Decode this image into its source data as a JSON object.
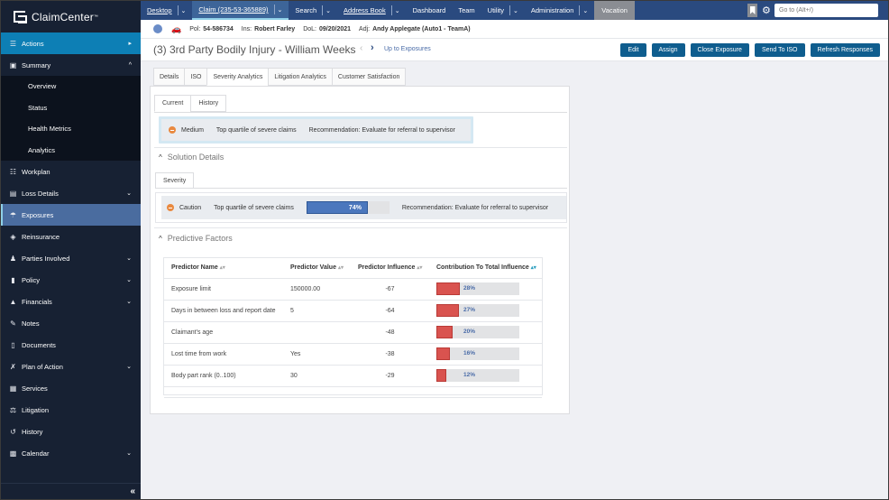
{
  "app": {
    "name": "ClaimCenter",
    "tm": "™"
  },
  "sidebar": {
    "items": [
      {
        "label": "Actions",
        "icon": "actions-icon",
        "chevron": "▸"
      },
      {
        "label": "Summary",
        "icon": "summary-icon",
        "chevron": "^"
      },
      {
        "label": "Workplan",
        "icon": "workplan-icon",
        "chevron": ""
      },
      {
        "label": "Loss Details",
        "icon": "loss-details-icon",
        "chevron": "⌄"
      },
      {
        "label": "Exposures",
        "icon": "exposures-icon",
        "chevron": ""
      },
      {
        "label": "Reinsurance",
        "icon": "reinsurance-icon",
        "chevron": ""
      },
      {
        "label": "Parties Involved",
        "icon": "parties-icon",
        "chevron": "⌄"
      },
      {
        "label": "Policy",
        "icon": "policy-icon",
        "chevron": "⌄"
      },
      {
        "label": "Financials",
        "icon": "financials-icon",
        "chevron": "⌄"
      },
      {
        "label": "Notes",
        "icon": "notes-icon",
        "chevron": ""
      },
      {
        "label": "Documents",
        "icon": "documents-icon",
        "chevron": ""
      },
      {
        "label": "Plan of Action",
        "icon": "plan-icon",
        "chevron": "⌄"
      },
      {
        "label": "Services",
        "icon": "services-icon",
        "chevron": ""
      },
      {
        "label": "Litigation",
        "icon": "litigation-icon",
        "chevron": ""
      },
      {
        "label": "History",
        "icon": "history-icon",
        "chevron": ""
      },
      {
        "label": "Calendar",
        "icon": "calendar-icon",
        "chevron": "⌄"
      }
    ],
    "summary_sub": [
      "Overview",
      "Status",
      "Health Metrics",
      "Analytics"
    ],
    "collapse": "«"
  },
  "topnav": {
    "items": [
      "Desktop",
      "Claim (235-53-365889)",
      "Search",
      "Address Book",
      "Dashboard",
      "Team",
      "Utility",
      "Administration",
      "Vacation"
    ],
    "goto_placeholder": "Go to (Alt+/)"
  },
  "infobar": {
    "pol_label": "Pol:",
    "pol": "54-586734",
    "ins_label": "Ins:",
    "ins": "Robert Farley",
    "dol_label": "DoL:",
    "dol": "09/20/2021",
    "adj_label": "Adj:",
    "adj": "Andy Applegate (Auto1 - TeamA)"
  },
  "title": {
    "text": "(3) 3rd Party Bodily Injury - William Weeks",
    "up_link": "Up to Exposures",
    "buttons": [
      "Edit",
      "Assign",
      "Close Exposure",
      "Send To ISO",
      "Refresh Responses"
    ]
  },
  "tabs": [
    "Details",
    "ISO",
    "Severity Analytics",
    "Litigation Analytics",
    "Customer Satisfaction"
  ],
  "subtabs": [
    "Current",
    "History"
  ],
  "summary": {
    "level": "Medium",
    "desc": "Top quartile of severe claims",
    "recommendation": "Recommendation: Evaluate for referral to supervisor"
  },
  "solution": {
    "heading": "Solution Details",
    "tab": "Severity",
    "level": "Caution",
    "desc": "Top quartile of severe claims",
    "percent": 74,
    "percent_label": "74%",
    "recommendation": "Recommendation: Evaluate for referral to supervisor"
  },
  "predictive": {
    "heading": "Predictive Factors",
    "columns": [
      "Predictor Name",
      "Predictor Value",
      "Predictor Influence",
      "Contribution To Total Influence"
    ],
    "rows": [
      {
        "name": "Exposure limit",
        "value": "150000.00",
        "influence": "-67",
        "contribution": 28,
        "contribution_label": "28%"
      },
      {
        "name": "Days in between loss and report date",
        "value": "5",
        "influence": "-64",
        "contribution": 27,
        "contribution_label": "27%"
      },
      {
        "name": "Claimant's age",
        "value": "",
        "influence": "-48",
        "contribution": 20,
        "contribution_label": "20%"
      },
      {
        "name": "Lost time from work",
        "value": "Yes",
        "influence": "-38",
        "contribution": 16,
        "contribution_label": "16%"
      },
      {
        "name": "Body part rank (0..100)",
        "value": "30",
        "influence": "-29",
        "contribution": 12,
        "contribution_label": "12%"
      }
    ]
  },
  "colors": {
    "accent": "#0f5d8e",
    "nav": "#2a4a7f",
    "sidebar": "#172133",
    "severity_bar": "#4b77bd",
    "contribution_bar": "#d9534f",
    "caution": "#e9893f"
  }
}
